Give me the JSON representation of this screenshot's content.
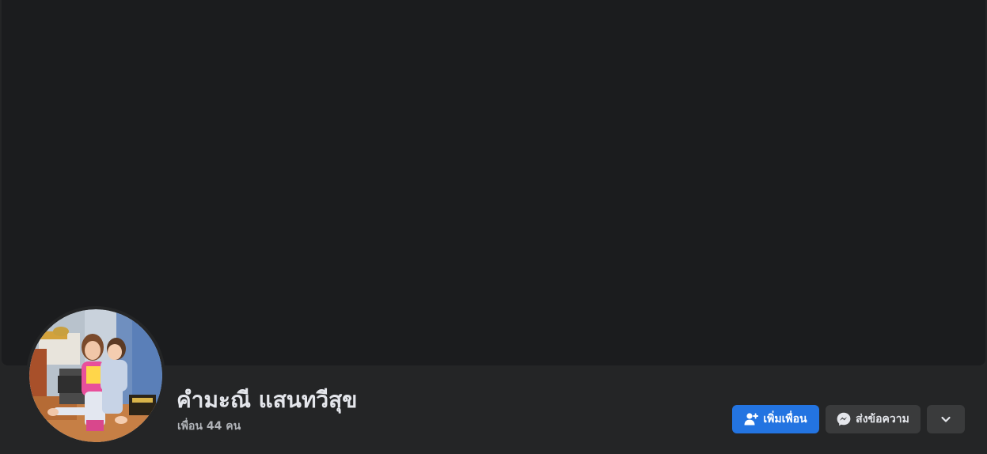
{
  "profile": {
    "name": "คำมะณี แสนทวีสุข",
    "friends_text": "เพื่อน 44 คน"
  },
  "actions": {
    "add_friend_label": "เพิ่มเพื่อน",
    "add_friend_icon": "add-friend-icon",
    "message_label": "ส่งข้อความ",
    "message_icon": "messenger-icon",
    "more_icon": "chevron-down-icon"
  },
  "colors": {
    "background": "#242526",
    "cover": "#1b1c1e",
    "primary_button": "#2374e1",
    "secondary_button": "#3a3b3c",
    "primary_text": "#e4e6eb",
    "secondary_text": "#b0b3b8"
  }
}
